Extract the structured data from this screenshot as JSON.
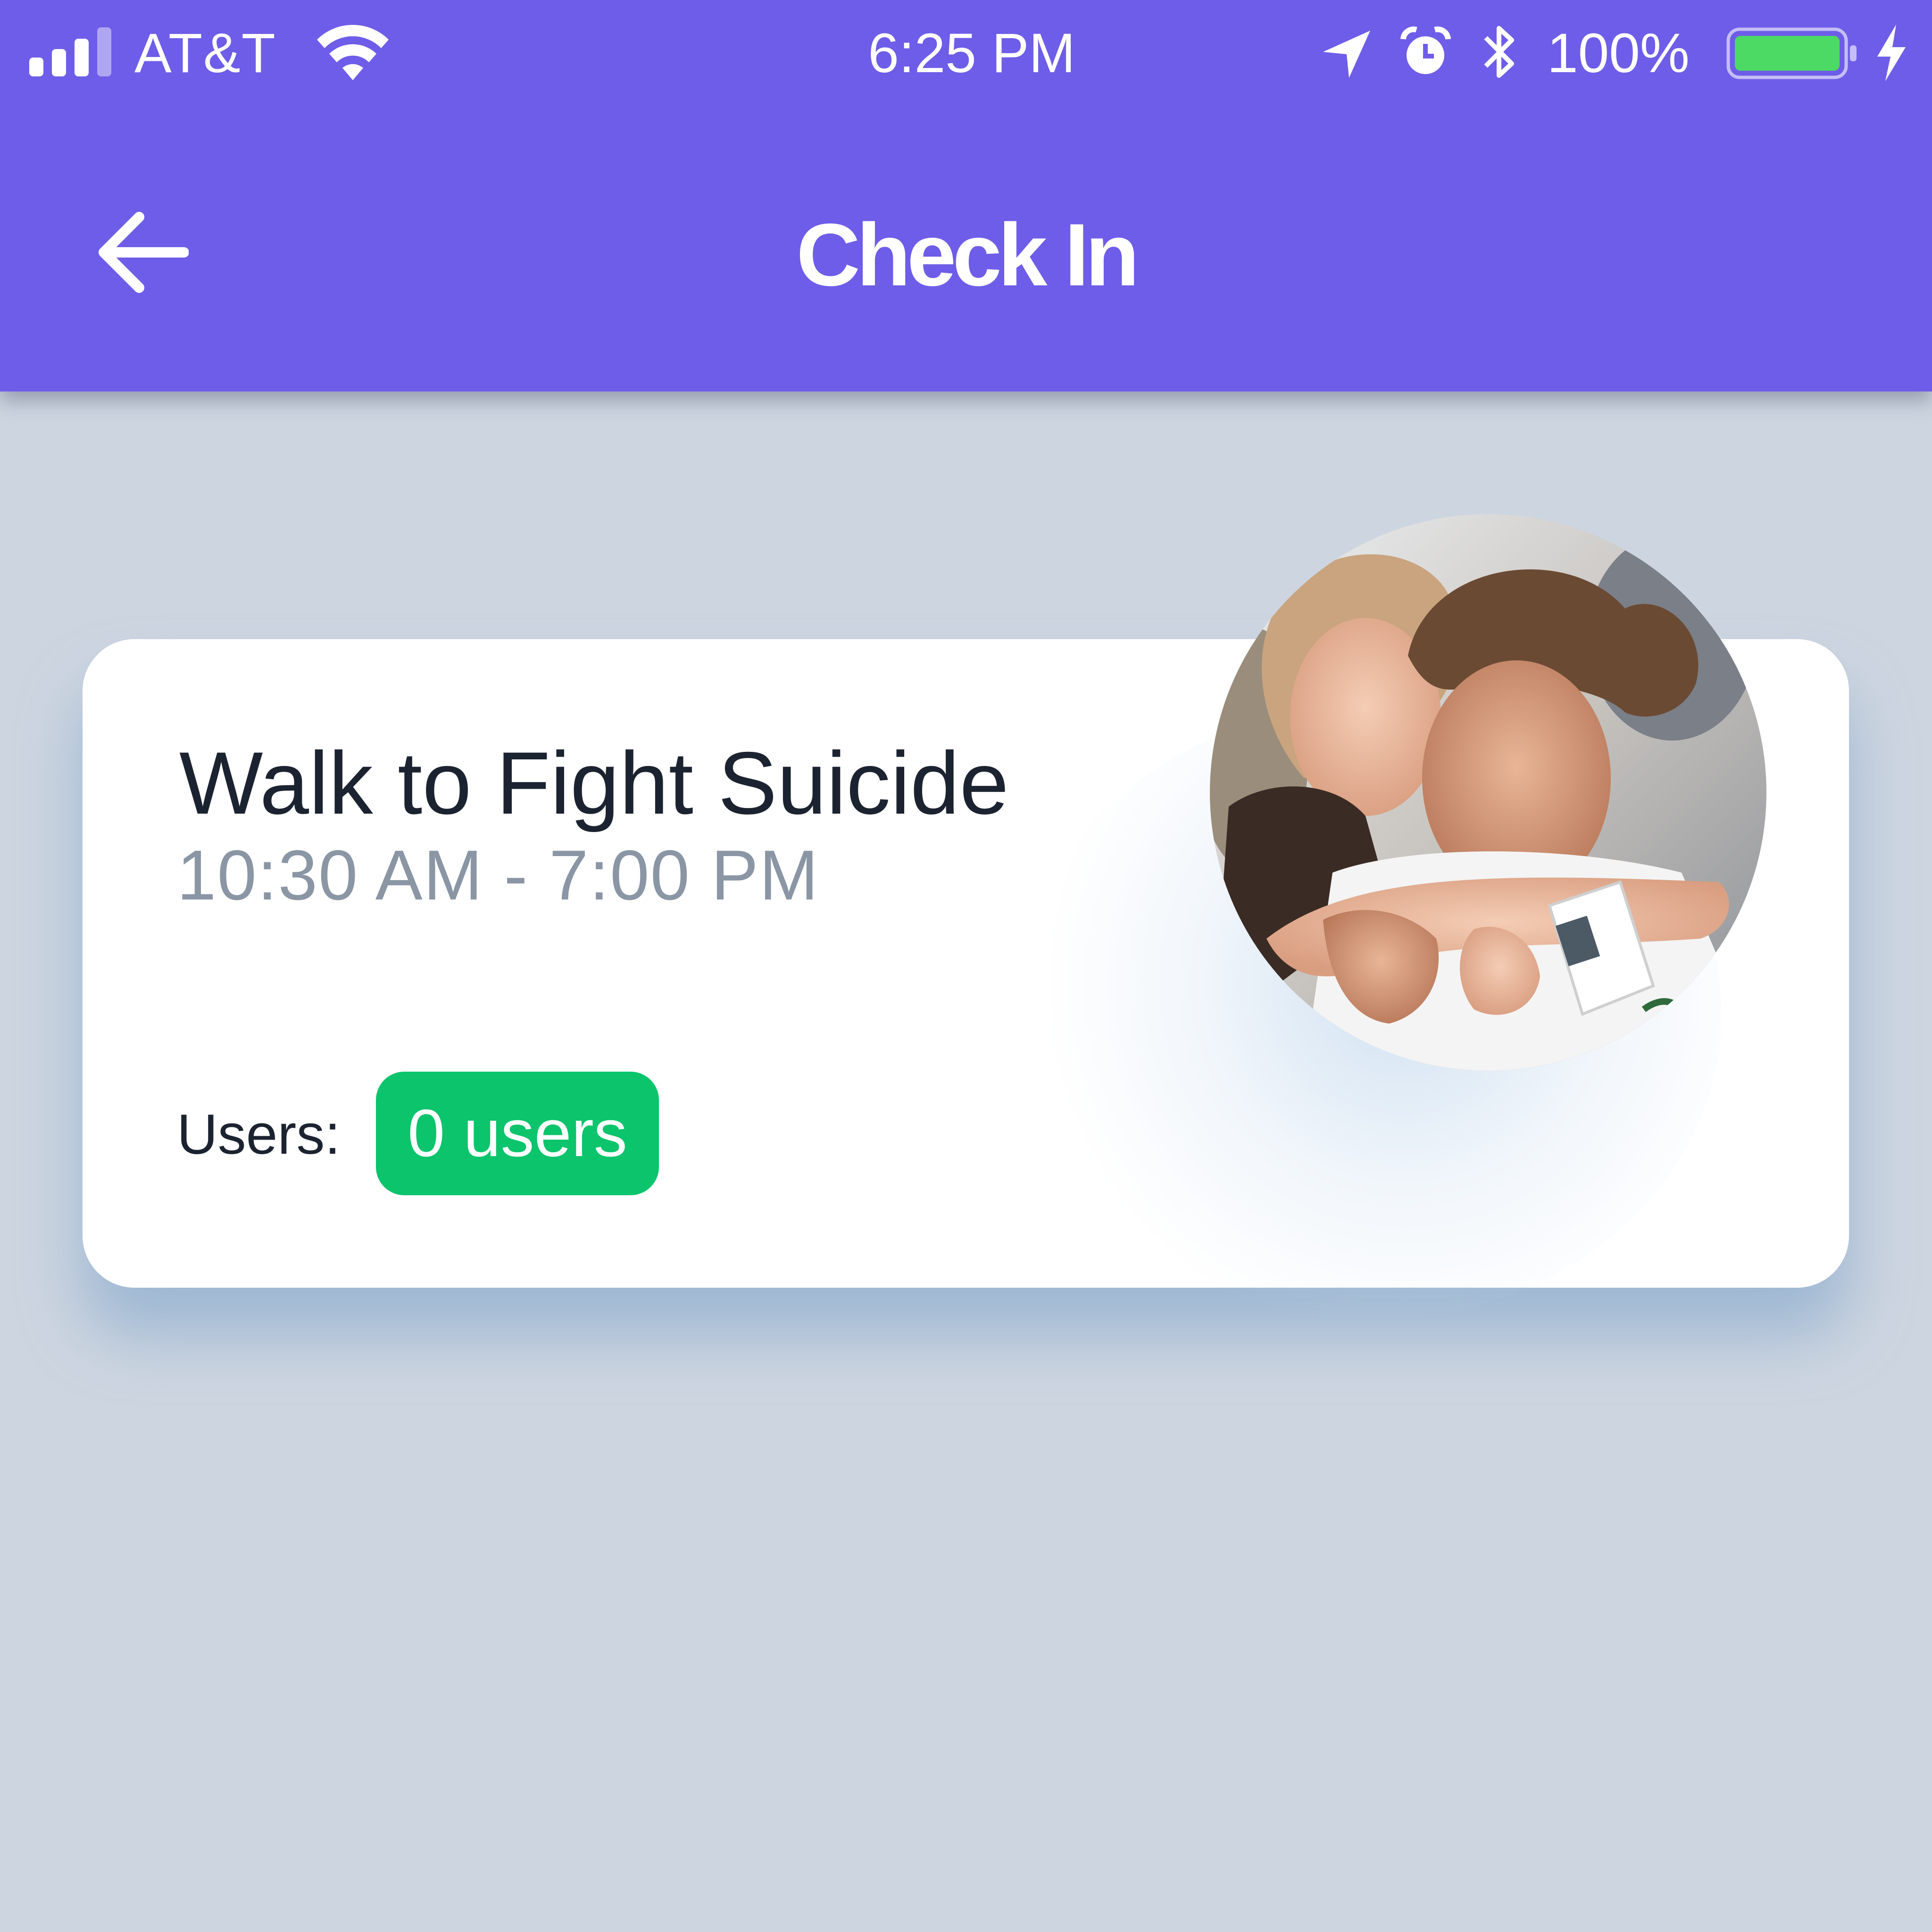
{
  "status_bar": {
    "carrier": "AT&T",
    "time": "6:25 PM",
    "battery_percent": "100%",
    "icons": [
      "signal-icon",
      "wifi-icon",
      "location-arrow-icon",
      "alarm-icon",
      "bluetooth-icon",
      "battery-icon",
      "charging-bolt-icon"
    ]
  },
  "header": {
    "title": "Check In",
    "back_icon": "arrow-left-icon"
  },
  "event": {
    "name": "Walk to Fight Suicide",
    "time_range": "10:30 AM - 7:00 PM",
    "users_label": "Users:",
    "users_badge": "0 users",
    "photo": "event-photo"
  },
  "colors": {
    "header": "#6e5de8",
    "background": "#cdd5e0",
    "badge": "#0bc46b",
    "battery_fill": "#4cd964"
  }
}
